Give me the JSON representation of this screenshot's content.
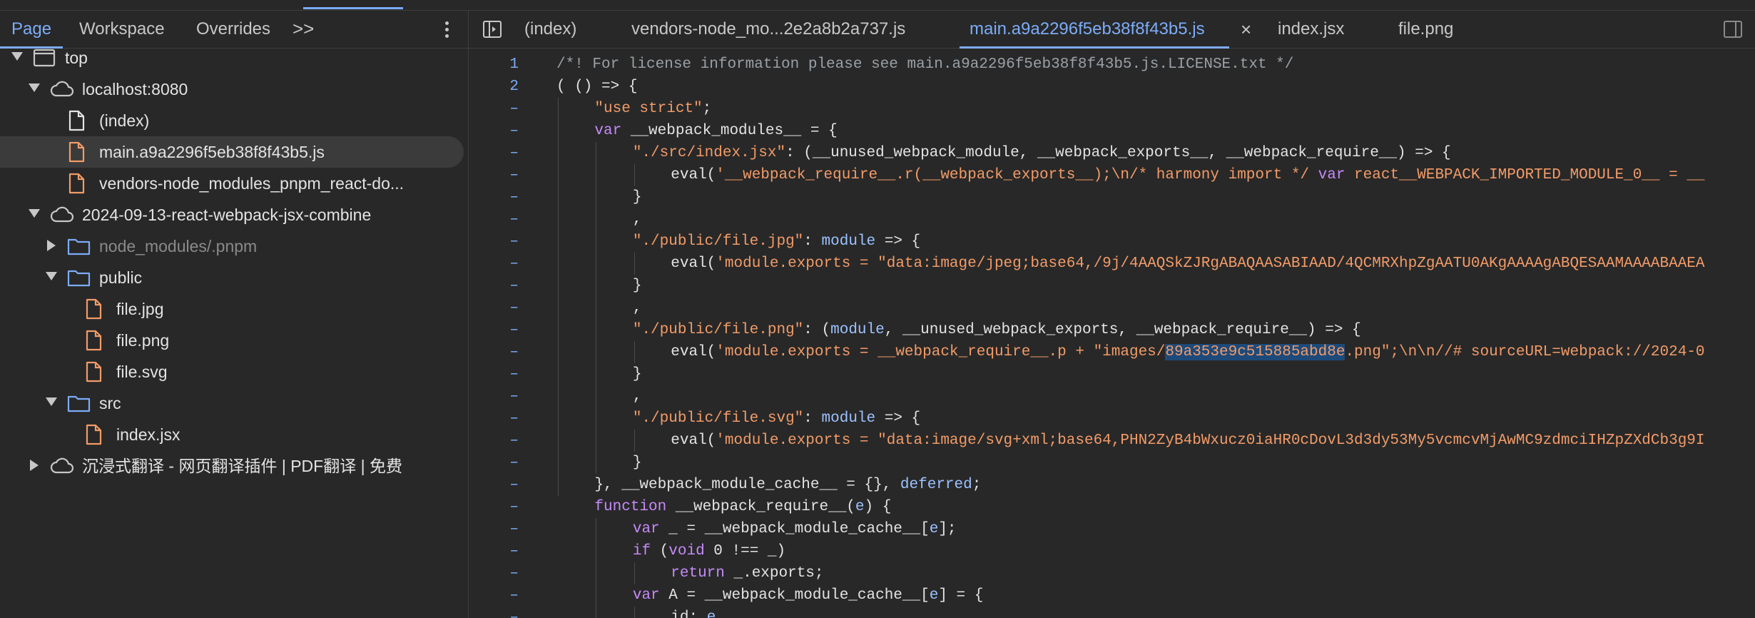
{
  "navigator": {
    "tabs": [
      "Page",
      "Workspace",
      "Overrides"
    ],
    "more": ">>",
    "tree": [
      {
        "label": "top",
        "icon": "frame-icon",
        "arrow": "down"
      },
      {
        "label": "localhost:8080",
        "icon": "cloud-icon",
        "arrow": "down"
      },
      {
        "label": "(index)",
        "icon": "document-icon",
        "arrow": ""
      },
      {
        "label": "main.a9a2296f5eb38f8f43b5.js",
        "icon": "js-file-icon",
        "arrow": "",
        "selected": true
      },
      {
        "label": "vendors-node_modules_pnpm_react-do...",
        "icon": "js-file-icon",
        "arrow": ""
      },
      {
        "label": "2024-09-13-react-webpack-jsx-combine",
        "icon": "cloud-icon",
        "arrow": "down"
      },
      {
        "label": "node_modules/.pnpm",
        "icon": "folder-icon",
        "arrow": "right",
        "dim": true
      },
      {
        "label": "public",
        "icon": "folder-icon",
        "arrow": "down"
      },
      {
        "label": "file.jpg",
        "icon": "file-icon",
        "arrow": ""
      },
      {
        "label": "file.png",
        "icon": "file-icon",
        "arrow": ""
      },
      {
        "label": "file.svg",
        "icon": "file-icon",
        "arrow": ""
      },
      {
        "label": "src",
        "icon": "folder-icon",
        "arrow": "down"
      },
      {
        "label": "index.jsx",
        "icon": "file-icon",
        "arrow": ""
      },
      {
        "label": "沉浸式翻译 - 网页翻译插件 | PDF翻译 | 免费",
        "icon": "cloud-icon",
        "arrow": "right"
      }
    ]
  },
  "editor": {
    "tabs": [
      "(index)",
      "vendors-node_mo...2e2a8b2a737.js",
      "main.a9a2296f5eb38f8f43b5.js",
      "index.jsx",
      "file.png"
    ],
    "active_tab": 2,
    "close_glyph": "×",
    "gutter": [
      "1",
      "2",
      "–",
      "–",
      "–",
      "–",
      "–",
      "–",
      "–",
      "–",
      "–",
      "–",
      "–",
      "–",
      "–",
      "–",
      "–",
      "–",
      "–",
      "–",
      "–",
      "–",
      "–",
      "–",
      "–",
      "–"
    ]
  },
  "code_lines": [
    "/*! For license information please see main.a9a2296f5eb38f8f43b5.js.LICENSE.txt */",
    "( () => {",
    "\"use strict\";",
    "var __webpack_modules__ = {",
    "\"./src/index.jsx\": (__unused_webpack_module, __webpack_exports__, __webpack_require__) => {",
    "eval('__webpack_require__.r(__webpack_exports__);\\n/* harmony import */ var react__WEBPACK_IMPORTED_MODULE_0__ = __",
    "}",
    ",",
    "\"./public/file.jpg\": module => {",
    "eval('module.exports = \"data:image/jpeg;base64,/9j/4AAQSkZJRgABAQAASABIAAD/4QCMRXhpZgAATU0AKgAAAAgABQESAAMAAAABAAEA",
    "}",
    ",",
    "\"./public/file.png\": (module, __unused_webpack_exports, __webpack_require__) => {",
    "eval('module.exports = __webpack_require__.p + \"images/89a353e9c515885abd8e.png\";\\n\\n//# sourceURL=webpack://2024-0",
    "}",
    ",",
    "\"./public/file.svg\": module => {",
    "eval('module.exports = \"data:image/svg+xml;base64,PHN2ZyB4bWxucz0iaHR0cDovL3d3dy53My5vcmcvMjAwMC9zdmciIHZpZXdCb3g9I",
    "}",
    "}, __webpack_module_cache__ = {}, deferred;",
    "function __webpack_require__(e) {",
    "var _ = __webpack_module_cache__[e];",
    "if (void 0 !== _)",
    "return _.exports;",
    "var A = __webpack_module_cache__[e] = {",
    "id: e,"
  ]
}
